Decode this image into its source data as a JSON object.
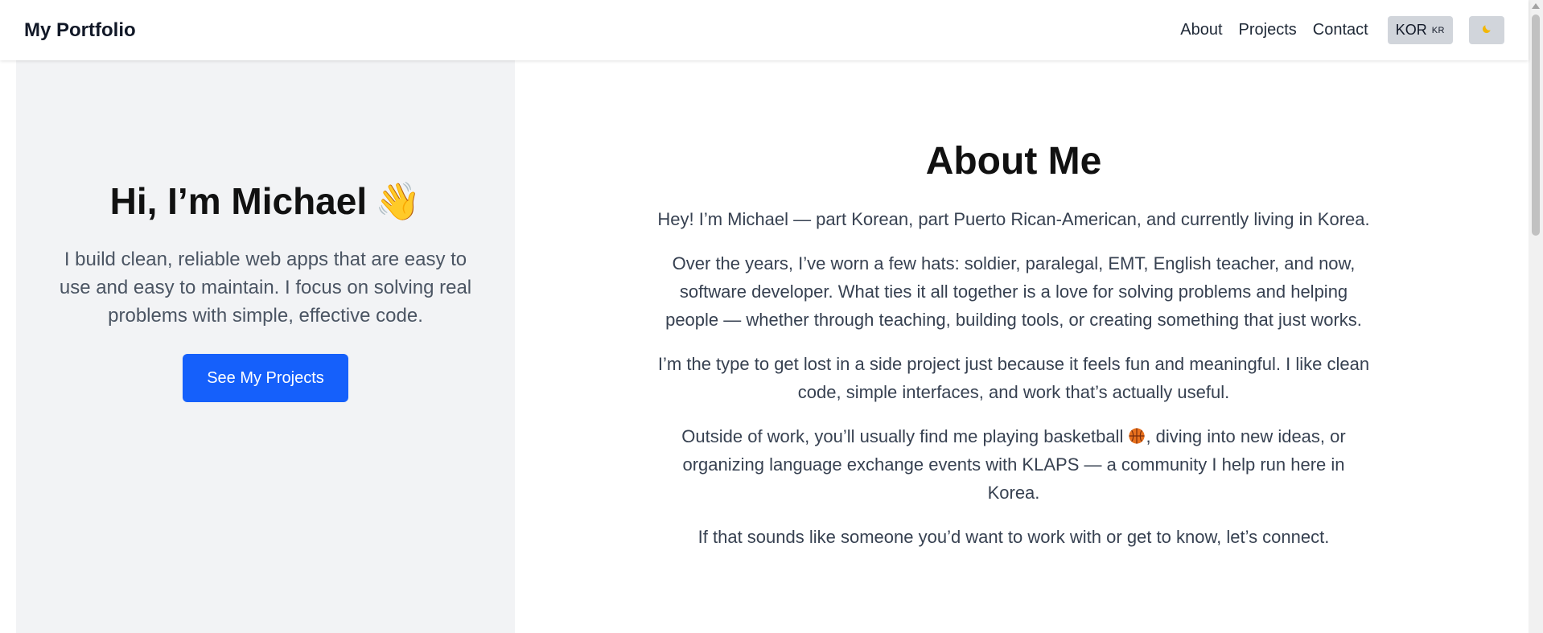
{
  "nav": {
    "brand": "My Portfolio",
    "links": [
      "About",
      "Projects",
      "Contact"
    ],
    "lang_label": "KOR",
    "lang_flag": "KR",
    "theme_icon": "moon-icon"
  },
  "hero": {
    "title": "Hi, I’m Michael",
    "wave": "👋",
    "subtitle": "I build clean, reliable web apps that are easy to use and easy to maintain. I focus on solving real problems with simple, effective code.",
    "cta": "See My Projects"
  },
  "about": {
    "title": "About Me",
    "p1": "Hey! I’m Michael — part Korean, part Puerto Rican-American, and currently living in Korea.",
    "p2": "Over the years, I’ve worn a few hats: soldier, paralegal, EMT, English teacher, and now, software developer. What ties it all together is a love for solving problems and helping people — whether through teaching, building tools, or creating something that just works.",
    "p3": "I’m the type to get lost in a side project just because it feels fun and meaningful. I like clean code, simple interfaces, and work that’s actually useful.",
    "p4_before": "Outside of work, you’ll usually find me playing basketball ",
    "p4_after": ", diving into new ideas, or organizing language exchange events with KLAPS — a community I help run here in Korea.",
    "p5": "If that sounds like someone you’d want to work with or get to know, let’s connect."
  },
  "colors": {
    "accent": "#1560fb",
    "hero_bg": "#f2f3f5",
    "button_gray": "#d1d5db"
  }
}
